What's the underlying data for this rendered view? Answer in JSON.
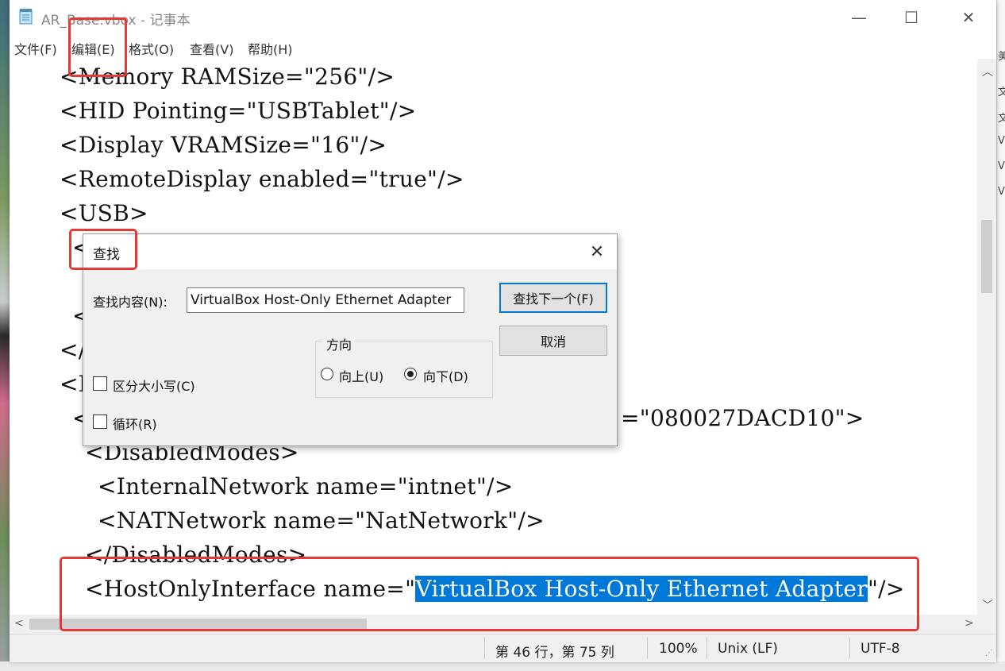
{
  "window": {
    "title": "AR_Base.vbox - 记事本",
    "minimize": "—",
    "maximize": "☐",
    "close": "✕"
  },
  "menu": [
    "文件(F)",
    "编辑(E)",
    "格式(O)",
    "查看(V)",
    "帮助(H)"
  ],
  "editor": {
    "lines": [
      "<Memory RAMSize=\"256\"/>",
      "<HID Pointing=\"USBTablet\"/>",
      "<Display VRAMSize=\"16\"/>",
      "<RemoteDisplay enabled=\"true\"/>",
      "<USB>",
      "<",
      "<",
      "</",
      "<N",
      "<",
      "<DisabledModes>",
      "<InternalNetwork name=\"intnet\"/>",
      "<NATNetwork name=\"NatNetwork\"/>",
      "</DisabledModes>",
      "<HostOnlyInterface name=\"",
      "\"/>"
    ],
    "mac_fragment": "=\"080027DACD10\">",
    "highlighted": "VirtualBox Host-Only Ethernet Adapter"
  },
  "status": {
    "position": "第 46 行，第 75 列",
    "zoom": "100%",
    "line_ending": "Unix (LF)",
    "encoding": "UTF-8"
  },
  "find_dialog": {
    "title": "查找",
    "find_label": "查找内容(N):",
    "find_value": "VirtualBox Host-Only Ethernet Adapter",
    "find_next": "查找下一个(F)",
    "cancel": "取消",
    "direction_label": "方向",
    "up": "向上(U)",
    "down": "向下(D)",
    "direction_selected": "down",
    "match_case": "区分大小写(C)",
    "match_case_checked": false,
    "wrap": "循环(R)",
    "wrap_checked": false,
    "close": "✕"
  },
  "desktop_right_glyphs": [
    "美",
    "文",
    "文",
    "Vi",
    "VB",
    "Vi"
  ],
  "colors": {
    "selection": "#0078d7",
    "annotation": "#e53935"
  }
}
